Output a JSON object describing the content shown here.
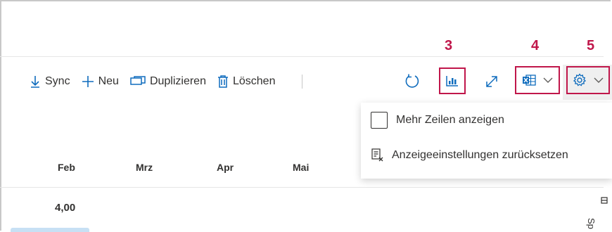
{
  "toolbar": {
    "sync_label": "Sync",
    "new_label": "Neu",
    "duplicate_label": "Duplizieren",
    "delete_label": "Löschen"
  },
  "callouts": [
    "3",
    "4",
    "5"
  ],
  "columns": [
    "Feb",
    "Mrz",
    "Apr",
    "Mai"
  ],
  "row_value": "4,00",
  "menu": {
    "show_more_rows": "Mehr Zeilen anzeigen",
    "reset_view_settings": "Anzeigeeinstellungen zurücksetzen"
  },
  "side_panel_text": "Sp",
  "colors": {
    "accent": "#0f6cbd",
    "callout": "#c0164a",
    "text": "#323130"
  }
}
